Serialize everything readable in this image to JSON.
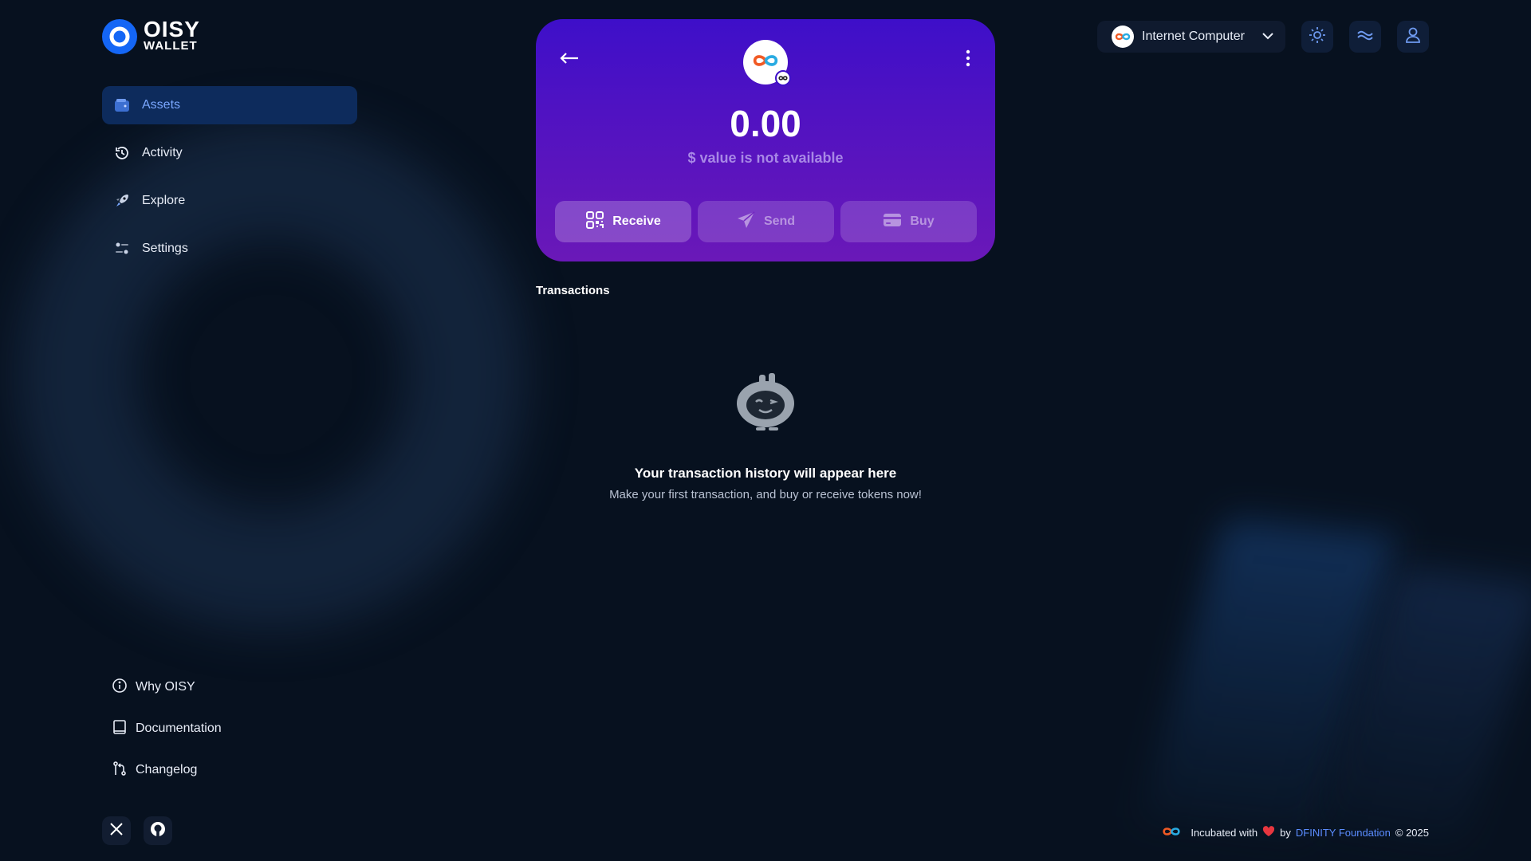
{
  "brand": {
    "line1": "OISY",
    "line2": "WALLET",
    "logo_icon": "oisy-ring-logo"
  },
  "nav": [
    {
      "label": "Assets",
      "icon": "wallet-icon",
      "active": true
    },
    {
      "label": "Activity",
      "icon": "history-icon",
      "active": false
    },
    {
      "label": "Explore",
      "icon": "rocket-icon",
      "active": false
    },
    {
      "label": "Settings",
      "icon": "sliders-icon",
      "active": false
    }
  ],
  "footer_links": [
    {
      "label": "Why OISY",
      "icon": "info-icon"
    },
    {
      "label": "Documentation",
      "icon": "book-icon"
    },
    {
      "label": "Changelog",
      "icon": "git-compare-icon"
    }
  ],
  "social": [
    {
      "icon": "x-icon"
    },
    {
      "icon": "github-icon"
    }
  ],
  "network": {
    "label": "Internet Computer",
    "icon": "icp-infinity-icon"
  },
  "top_buttons": [
    {
      "icon": "sun-icon"
    },
    {
      "icon": "waves-icon"
    },
    {
      "icon": "user-icon"
    }
  ],
  "token_card": {
    "balance": "0.00",
    "usd_note": "$ value is not available",
    "actions": {
      "receive": "Receive",
      "send": "Send",
      "buy": "Buy"
    }
  },
  "transactions": {
    "title": "Transactions",
    "empty_title": "Your transaction history will appear here",
    "empty_subtitle": "Make your first transaction, and buy or receive tokens now!"
  },
  "footer": {
    "prefix": "Incubated with",
    "by": "by",
    "org": "DFINITY Foundation",
    "copyright": "© 2025"
  },
  "colors": {
    "accent": "#1466f5",
    "card_top": "#3e0fc9",
    "card_bottom": "#6a18b8",
    "active_nav_bg": "#0d2b5c"
  }
}
